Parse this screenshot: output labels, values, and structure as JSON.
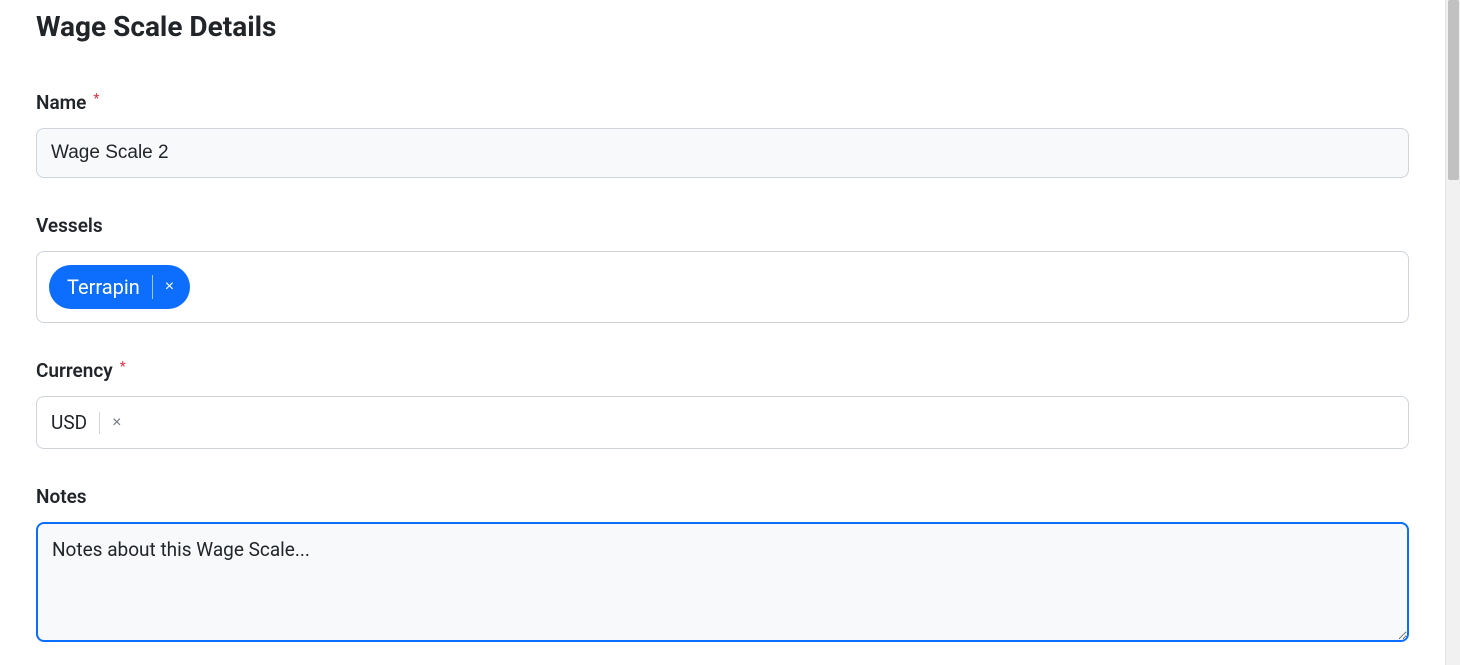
{
  "page": {
    "title": "Wage Scale Details"
  },
  "form": {
    "name": {
      "label": "Name",
      "required": true,
      "value": "Wage Scale 2"
    },
    "vessels": {
      "label": "Vessels",
      "tags": [
        {
          "label": "Terrapin"
        }
      ]
    },
    "currency": {
      "label": "Currency",
      "required": true,
      "value": "USD"
    },
    "notes": {
      "label": "Notes",
      "value": "Notes about this Wage Scale..."
    }
  },
  "symbols": {
    "asterisk": "*",
    "close": "×"
  }
}
